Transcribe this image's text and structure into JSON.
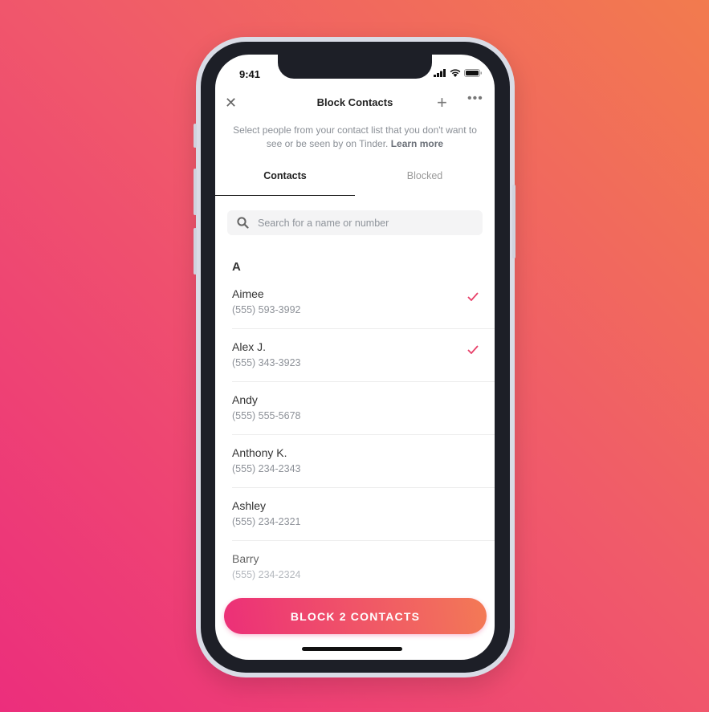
{
  "status": {
    "time": "9:41"
  },
  "header": {
    "title": "Block Contacts"
  },
  "description": {
    "text": "Select people from your contact list that you don't want to see or be seen by on Tinder.",
    "link": "Learn more"
  },
  "tabs": [
    {
      "label": "Contacts",
      "active": true
    },
    {
      "label": "Blocked",
      "active": false
    }
  ],
  "search": {
    "placeholder": "Search for a name or number"
  },
  "section_letter": "A",
  "contacts": [
    {
      "name": "Aimee",
      "phone": "(555) 593-3992",
      "selected": true
    },
    {
      "name": "Alex J.",
      "phone": "(555) 343-3923",
      "selected": true
    },
    {
      "name": "Andy",
      "phone": "(555) 555-5678",
      "selected": false
    },
    {
      "name": "Anthony K.",
      "phone": "(555) 234-2343",
      "selected": false
    },
    {
      "name": "Ashley",
      "phone": "(555) 234-2321",
      "selected": false
    },
    {
      "name": "Barry",
      "phone": "(555) 234-2324",
      "selected": false
    }
  ],
  "action": {
    "label": "BLOCK 2 CONTACTS"
  },
  "colors": {
    "accent": "#ec2f78",
    "check": "#e8416a"
  }
}
